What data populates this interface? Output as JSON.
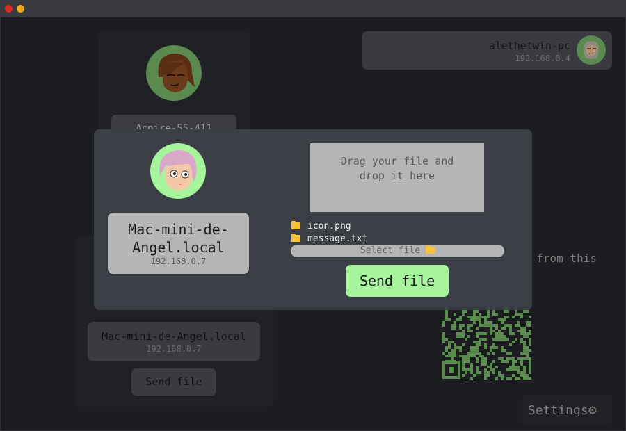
{
  "window": {
    "close_color": "#e0281d",
    "minimize_color": "#f1a81f"
  },
  "background": {
    "peer_partial_name": "Acpire-55-411",
    "host": {
      "name": "alethetwin-pc",
      "ip": "192.168.0.4"
    },
    "partial_hint_text": "e from this",
    "device": {
      "name": "Mac-mini-de-Angel.local",
      "ip": "192.168.0.7"
    },
    "send_label": "Send file",
    "settings_label": "Settings",
    "settings_icon": "gear-icon"
  },
  "modal": {
    "device_name_line1": "Mac-mini-de-",
    "device_name_line2": "Angel.local",
    "device_ip": "192.168.0.7",
    "dropzone_line1": "Drag your file and",
    "dropzone_line2": "drop it here",
    "files": [
      "icon.png",
      "message.txt"
    ],
    "select_file_label": "Select file",
    "send_label": "Send file"
  },
  "colors": {
    "accent": "#a6f59c",
    "modal_bg": "#3c3e45",
    "card_bg": "#b5b5b5",
    "folder": "#f5c23a"
  }
}
